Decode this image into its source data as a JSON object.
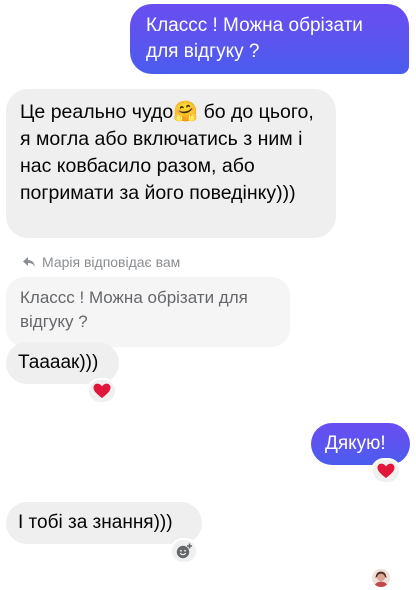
{
  "messages": {
    "m1": "Классс ! Можна обрізати для відгуку ?",
    "m2_before_emoji": "Це реально чудо",
    "m2_emoji": "🤗",
    "m2_after_emoji": " бо до цього, я могла або включатись з ним і нас ковбасило разом, або погримати за його поведінку)))",
    "reply_label": "Марія відповідає вам",
    "quoted": "Классс ! Можна обрізати для відгуку ?",
    "m3": "Таааак)))",
    "m4": "Дякую!",
    "m5": "І тобі за знання)))"
  },
  "reactions": {
    "m3": "heart",
    "m4": "heart"
  },
  "icons": {
    "reply": "reply-arrow-icon",
    "add_reaction": "add-reaction-icon",
    "heart": "heart-icon"
  },
  "colors": {
    "outgoing_bubble": "#5a55ee",
    "incoming_bubble": "#efefef",
    "heart": "#e0173a",
    "muted_text": "#8a8d91"
  }
}
